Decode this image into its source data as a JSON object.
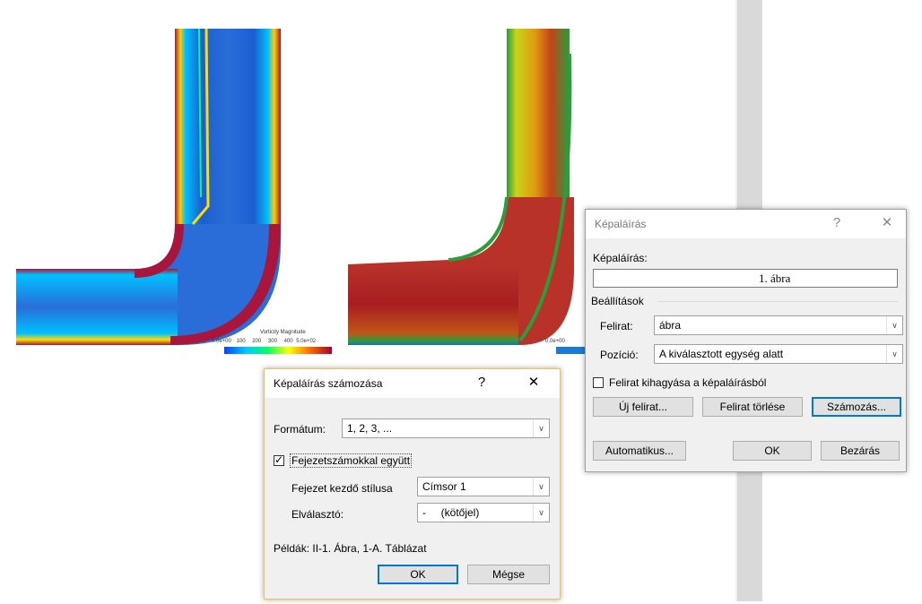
{
  "figure_left": {
    "legend_title": "Vorticity Magnitude",
    "legend_ticks": [
      "0.0e+00",
      "100",
      "200",
      "300",
      "400",
      "5.0e+02"
    ]
  },
  "figure_right": {
    "legend_tick_first": "0.0e+00"
  },
  "caption_dialog": {
    "title": "Képaláírás",
    "help_icon": "?",
    "close_icon": "✕",
    "caption_label": "Képaláírás:",
    "caption_value": "1. ábra",
    "settings_label": "Beállítások",
    "label_label": "Felirat:",
    "label_value": "ábra",
    "position_label": "Pozíció:",
    "position_value": "A kiválasztott egység alatt",
    "exclude_label": "Felirat kihagyása a képaláírásból",
    "exclude_checked": false,
    "new_label_button": "Új felirat...",
    "delete_label_button": "Felirat törlése",
    "numbering_button": "Számozás...",
    "autocaption_button": "Automatikus...",
    "ok_button": "OK",
    "close_button": "Bezárás"
  },
  "numbering_dialog": {
    "title": "Képaláírás számozása",
    "help_icon": "?",
    "close_icon": "✕",
    "format_label": "Formátum:",
    "format_value": "1, 2, 3, ...",
    "include_chapter_label": "Fejezetszámokkal együtt",
    "include_chapter_checked": true,
    "chapter_style_label": "Fejezet kezdő stílusa",
    "chapter_style_value": "Címsor 1",
    "separator_label": "Elválasztó:",
    "separator_value": "-     (kötőjel)",
    "examples_label": "Példák:  II-1. Ábra, 1-A. Táblázat",
    "ok_button": "OK",
    "cancel_button": "Mégse"
  },
  "colors": {
    "dialog_bg": "#f0f0f0",
    "focus_blue": "#0078d7",
    "border_orange": "#f0c060",
    "flow_blue": "#1f6fd0",
    "flow_red": "#b01e2a"
  }
}
